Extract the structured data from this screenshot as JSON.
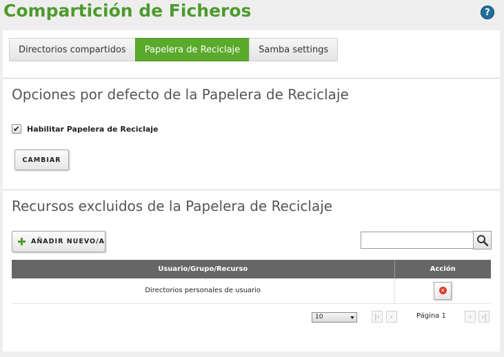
{
  "header": {
    "title": "Compartición de Ficheros",
    "help_label": "?"
  },
  "tabs": [
    {
      "label": "Directorios compartidos",
      "active": false
    },
    {
      "label": "Papelera de Reciclaje",
      "active": true
    },
    {
      "label": "Samba settings",
      "active": false
    }
  ],
  "defaults_section": {
    "title": "Opciones por defecto de la Papelera de Reciclaje",
    "checkbox_label": "Habilitar Papelera de Reciclaje",
    "checkbox_checked": true,
    "checkbox_mark": "✔",
    "submit_label": "CAMBIAR"
  },
  "excluded_section": {
    "title": "Recursos excluidos de la Papelera de Reciclaje",
    "add_label": "AÑADIR NUEVO/A",
    "search_value": "",
    "table": {
      "columns": [
        "Usuario/Grupo/Recurso",
        "Acción"
      ],
      "rows": [
        {
          "resource": "Directorios personales de usuario",
          "action_icon": "delete-icon"
        }
      ]
    },
    "pagination": {
      "page_size": "10",
      "page_label": "Página 1"
    }
  },
  "colors": {
    "brand_green": "#4e9a2e",
    "active_tab": "#5aaa2c",
    "table_header": "#666666",
    "delete_red": "#e03a2a"
  }
}
